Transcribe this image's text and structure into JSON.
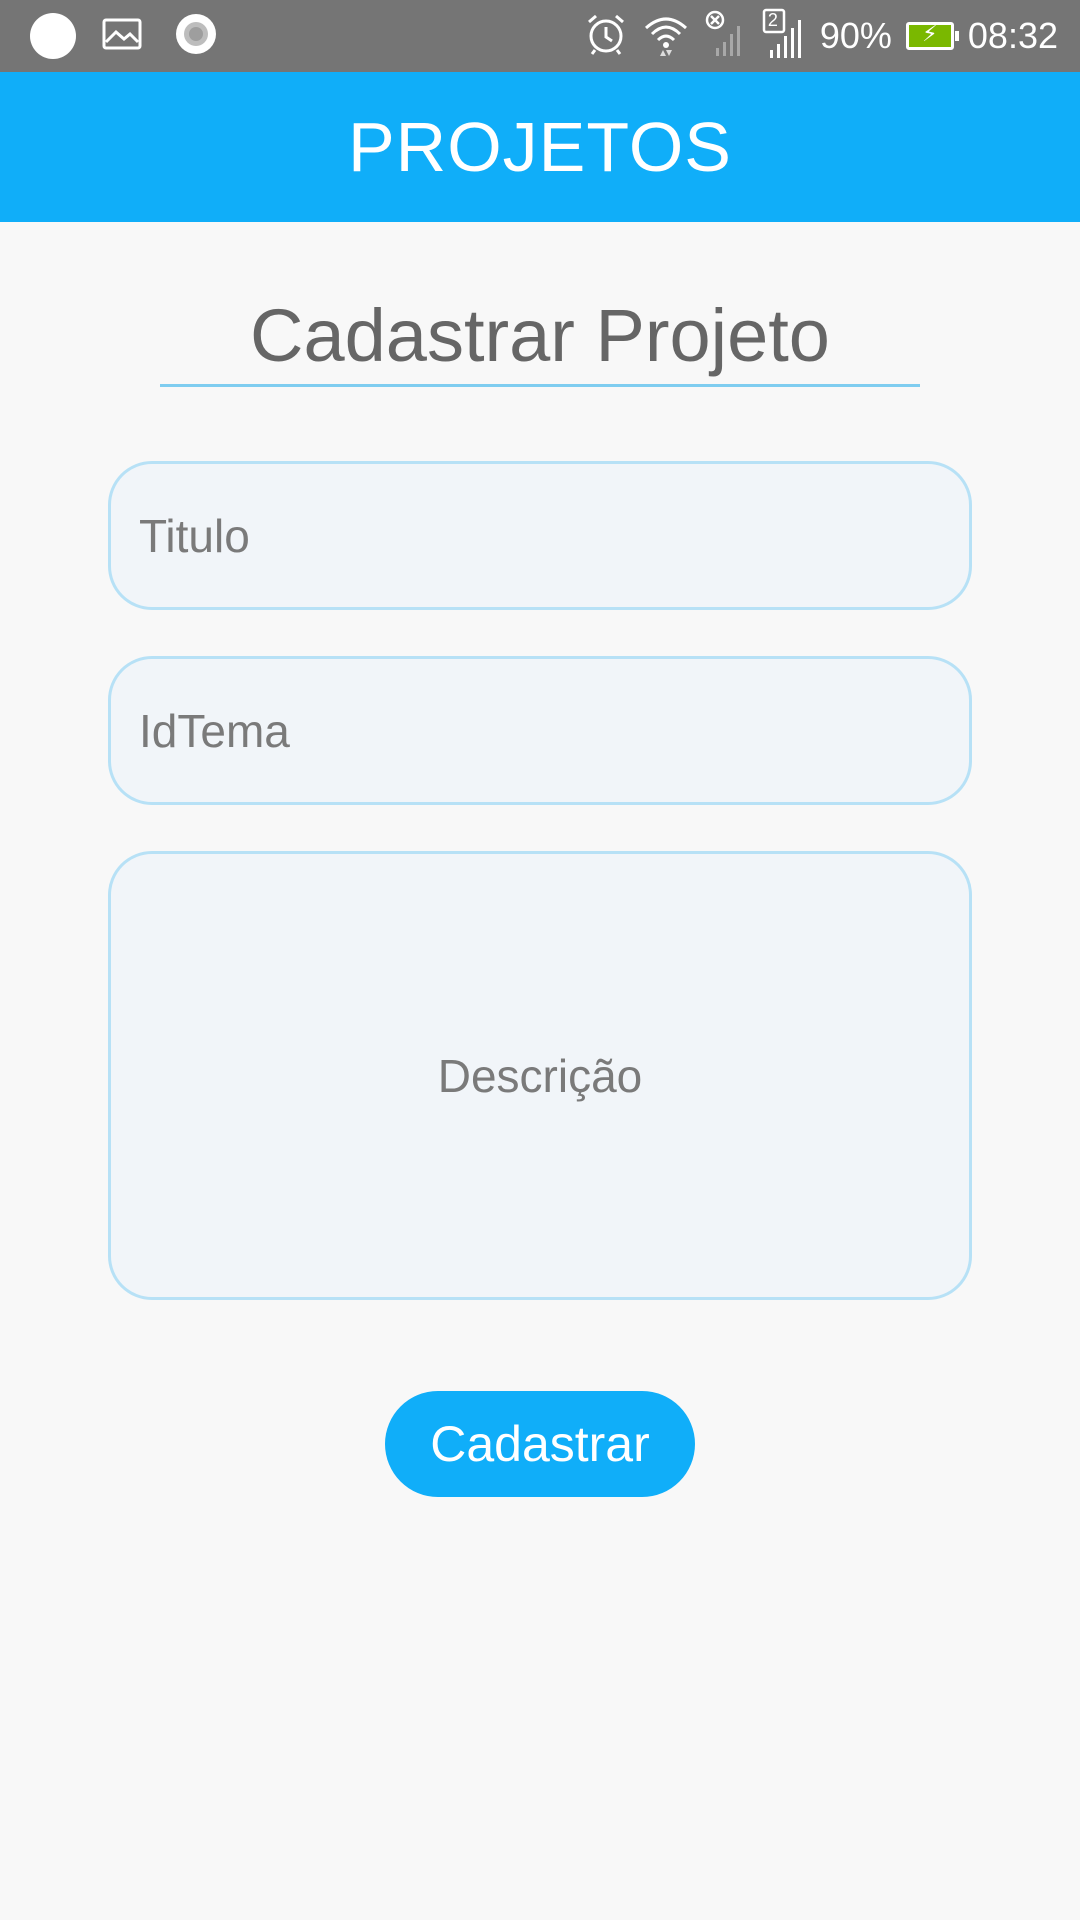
{
  "status_bar": {
    "battery_percent": "90%",
    "time": "08:32",
    "sim_number": "2",
    "icons": [
      "notification-dot-icon",
      "gallery-icon",
      "record-icon",
      "alarm-icon",
      "wifi-icon",
      "no-signal-icon",
      "signal-icon",
      "battery-icon"
    ],
    "battery_color": "#7ab800"
  },
  "app_bar": {
    "title": "PROJETOS",
    "color": "#10aef9"
  },
  "form": {
    "heading": "Cadastrar Projeto",
    "titulo_placeholder": "Titulo",
    "idtema_placeholder": "IdTema",
    "descricao_placeholder": "Descrição",
    "submit_label": "Cadastrar"
  }
}
